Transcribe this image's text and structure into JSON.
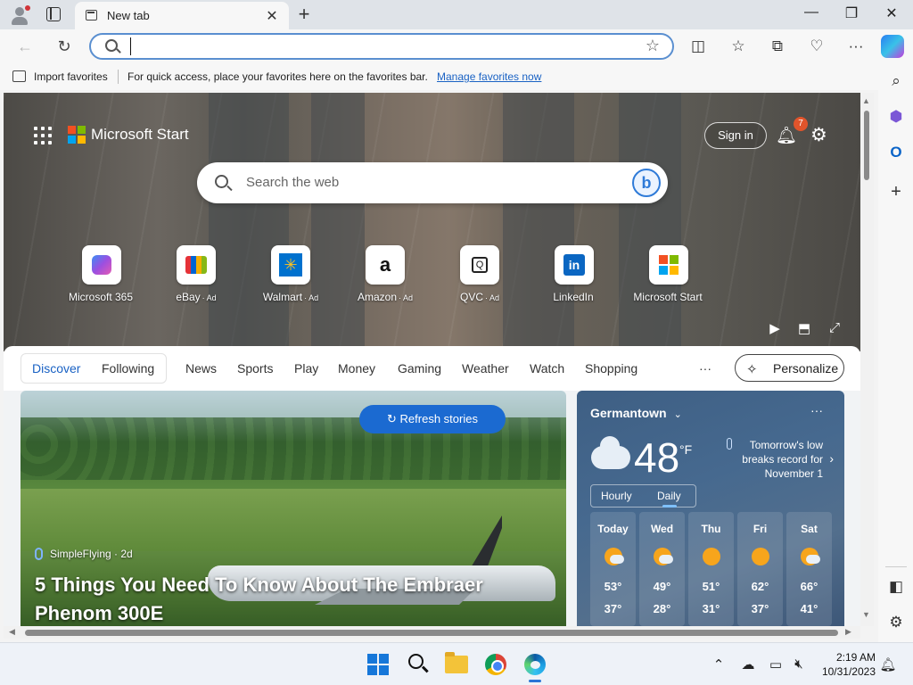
{
  "tab": {
    "title": "New tab"
  },
  "address_bar": {
    "value": "",
    "placeholder": ""
  },
  "favorites_bar": {
    "import_label": "Import favorites",
    "message": "For quick access, place your favorites here on the favorites bar.",
    "manage_link": "Manage favorites now"
  },
  "start": {
    "brand": "Microsoft Start",
    "sign_in": "Sign in",
    "notification_count": "7",
    "search_placeholder": "Search the web",
    "quick_links": [
      {
        "label": "Microsoft 365",
        "ad": ""
      },
      {
        "label": "eBay",
        "ad": "· Ad"
      },
      {
        "label": "Walmart",
        "ad": "· Ad"
      },
      {
        "label": "Amazon",
        "ad": "· Ad"
      },
      {
        "label": "QVC",
        "ad": "· Ad"
      },
      {
        "label": "LinkedIn",
        "ad": ""
      },
      {
        "label": "Microsoft Start",
        "ad": ""
      }
    ]
  },
  "feed_nav": {
    "items": [
      "Discover",
      "Following",
      "News",
      "Sports",
      "Play",
      "Money",
      "Gaming",
      "Weather",
      "Watch",
      "Shopping"
    ],
    "more": "···",
    "personalize": "Personalize"
  },
  "story": {
    "refresh": "Refresh stories",
    "source": "SimpleFlying · 2d",
    "title": "5 Things You Need To Know About The Embraer Phenom 300E"
  },
  "weather": {
    "location": "Germantown",
    "more": "···",
    "temp": "48",
    "unit": "°F",
    "alert": "Tomorrow's low breaks record for November 1",
    "tabs": [
      "Hourly",
      "Daily"
    ],
    "days": [
      {
        "name": "Today",
        "hi": "53°",
        "lo": "37°"
      },
      {
        "name": "Wed",
        "hi": "49°",
        "lo": "28°"
      },
      {
        "name": "Thu",
        "hi": "51°",
        "lo": "31°"
      },
      {
        "name": "Fri",
        "hi": "62°",
        "lo": "37°"
      },
      {
        "name": "Sat",
        "hi": "66°",
        "lo": "41°"
      }
    ]
  },
  "taskbar": {
    "time": "2:19 AM",
    "date": "10/31/2023"
  },
  "colors": {
    "accent": "#1a62c4",
    "refresh_button": "#1b6ad1",
    "notification_badge": "#e0542b"
  }
}
